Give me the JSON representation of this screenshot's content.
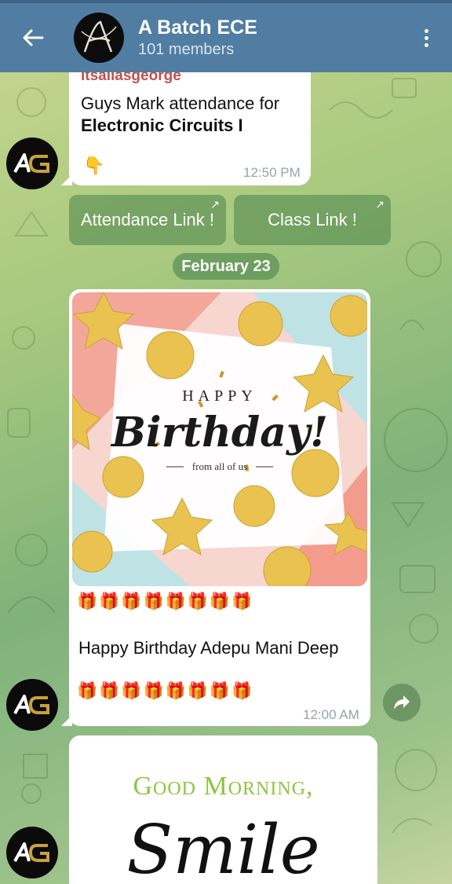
{
  "header": {
    "title": "A Batch ECE",
    "subtitle": "101 members",
    "avatar_icon": "calligraphy-a-logo",
    "back_icon": "arrow-left-icon",
    "menu_icon": "kebab-menu-icon",
    "color": "#517da2"
  },
  "messages": [
    {
      "sender": "itsaliasgeorge",
      "line1": "Guys Mark attendance for",
      "line2": "Electronic Circuits I",
      "emoji": "👇",
      "time": "12:50 PM"
    }
  ],
  "inline_buttons": {
    "attendance": "Attendance Link !",
    "class": "Class Link !"
  },
  "date_separator": "February 23",
  "birthday_post": {
    "image_happy": "HAPPY",
    "image_birthday": "Birthday!",
    "image_from": "from all of us",
    "gifts": "🎁🎁🎁🎁🎁🎁🎁🎁",
    "text": "Happy Birthday Adepu Mani Deep",
    "time": "12:00 AM"
  },
  "morning_post": {
    "title": "Good Morning,",
    "word": "Smile"
  },
  "avatar_initials": "AG"
}
